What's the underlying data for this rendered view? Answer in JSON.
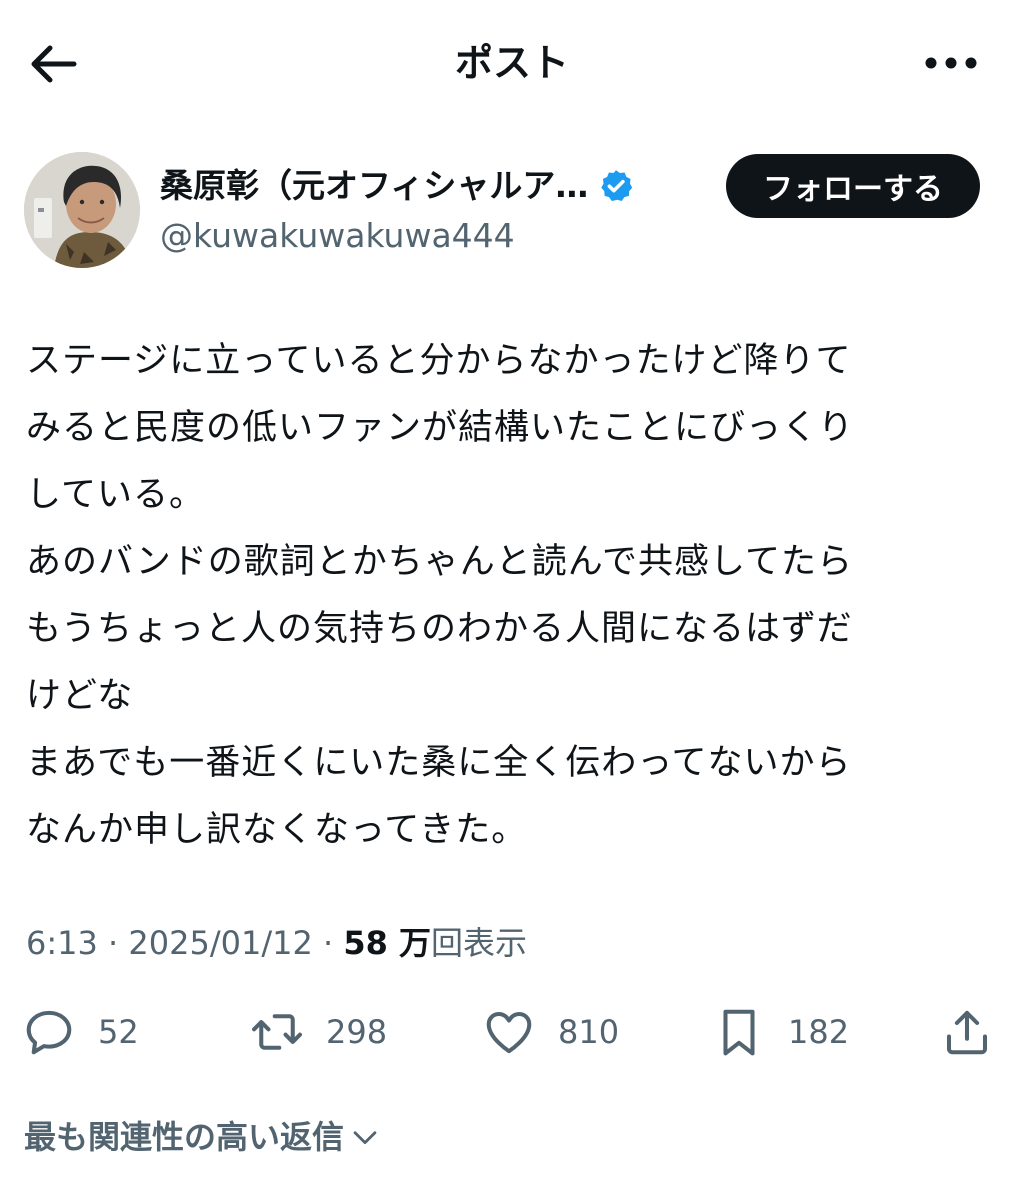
{
  "header": {
    "title": "ポスト"
  },
  "author": {
    "display_name": "桑原彰（元オフィシャルア…",
    "handle": "@kuwakuwakuwa444",
    "follow_label": "フォローする"
  },
  "post": {
    "lines": [
      "ステージに立っていると分からなかったけど降りて",
      "みると民度の低いファンが結構いたことにびっくり",
      "している。",
      "あのバンドの歌詞とかちゃんと読んで共感してたら",
      "もうちょっと人の気持ちのわかる人間になるはずだ",
      "けどな",
      "まあでも一番近くにいた桑に全く伝わってないから",
      "なんか申し訳なくなってきた。"
    ]
  },
  "meta": {
    "time": "6:13",
    "separator": " · ",
    "date": "2025/01/12",
    "views_number": "58 万",
    "views_suffix": "回表示"
  },
  "actions": {
    "replies": "52",
    "reposts": "298",
    "likes": "810",
    "bookmarks": "182"
  },
  "replies_sort": {
    "label": "最も関連性の高い返信"
  },
  "colors": {
    "text": "#0f1419",
    "secondary": "#536471",
    "verified": "#1d9bf0",
    "follow_bg": "#0f1419"
  },
  "icons": [
    "arrow-left-icon",
    "more-horizontal-icon",
    "verified-badge-icon",
    "reply-icon",
    "repost-icon",
    "like-icon",
    "bookmark-icon",
    "share-icon",
    "chevron-down-icon"
  ]
}
